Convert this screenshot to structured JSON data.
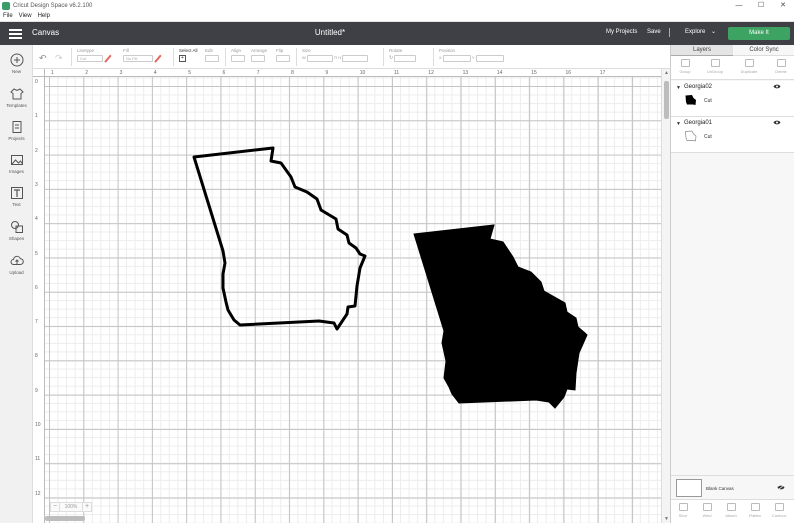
{
  "window": {
    "title": "Cricut Design Space  v6.2.100",
    "controls": [
      "—",
      "☐",
      "✕"
    ]
  },
  "menu": [
    "File",
    "View",
    "Help"
  ],
  "header": {
    "app_section": "Canvas",
    "document_title": "Untitled*",
    "my_projects": "My Projects",
    "save": "Save",
    "separator": "|",
    "explore": "Explore",
    "explore_chevron": "⌄",
    "make_it": "Make It",
    "make_it_color": "#3ca363"
  },
  "toolbar": {
    "undo": "↶",
    "redo": "↷",
    "linetype_label": "Linetype",
    "linetype_value": "Cut",
    "fill_label": "Fill",
    "fill_value": "No Fill",
    "select_all_label": "Select All",
    "edit_label": "Edit",
    "align_label": "Align",
    "arrange_label": "Arrange",
    "flip_label": "Flip",
    "size_label": "Size",
    "size_w": "W",
    "size_h": "H",
    "rotate_label": "Rotate",
    "position_label": "Position",
    "position_x": "X",
    "position_y": "Y"
  },
  "sidebar": [
    {
      "label": "New",
      "icon": "plus-circle-icon"
    },
    {
      "label": "Templates",
      "icon": "tshirt-icon"
    },
    {
      "label": "Projects",
      "icon": "projects-icon"
    },
    {
      "label": "Images",
      "icon": "image-icon"
    },
    {
      "label": "Text",
      "icon": "text-t-icon"
    },
    {
      "label": "Shapes",
      "icon": "shapes-icon"
    },
    {
      "label": "Upload",
      "icon": "cloud-upload-icon"
    }
  ],
  "ruler": {
    "top_ticks": [
      "1",
      "2",
      "3",
      "4",
      "5",
      "6",
      "7",
      "8",
      "9",
      "10",
      "11",
      "12",
      "13",
      "14",
      "15",
      "16",
      "17"
    ],
    "left_ticks": [
      "0",
      "1",
      "2",
      "3",
      "4",
      "5",
      "6",
      "7",
      "8",
      "9",
      "10",
      "11",
      "12"
    ]
  },
  "zoom": {
    "minus": "−",
    "value": "100%",
    "plus": "+"
  },
  "right_panel": {
    "tabs": [
      "Layers",
      "Color Sync"
    ],
    "layer_tools": [
      "Group",
      "UnGroup",
      "Duplicate",
      "Delete"
    ],
    "layers": [
      {
        "name": "Georgia02",
        "operation": "Cut",
        "filled": true
      },
      {
        "name": "Georgia01",
        "operation": "Cut",
        "filled": false
      }
    ],
    "blank_canvas": "Blank Canvas",
    "bottom_tools": [
      "Slice",
      "Weld",
      "Attach",
      "Flatten",
      "Contour"
    ]
  },
  "colors": {
    "header_bg": "#3e4046",
    "shape_fill": "#000000",
    "shape_outline": "#000000"
  }
}
